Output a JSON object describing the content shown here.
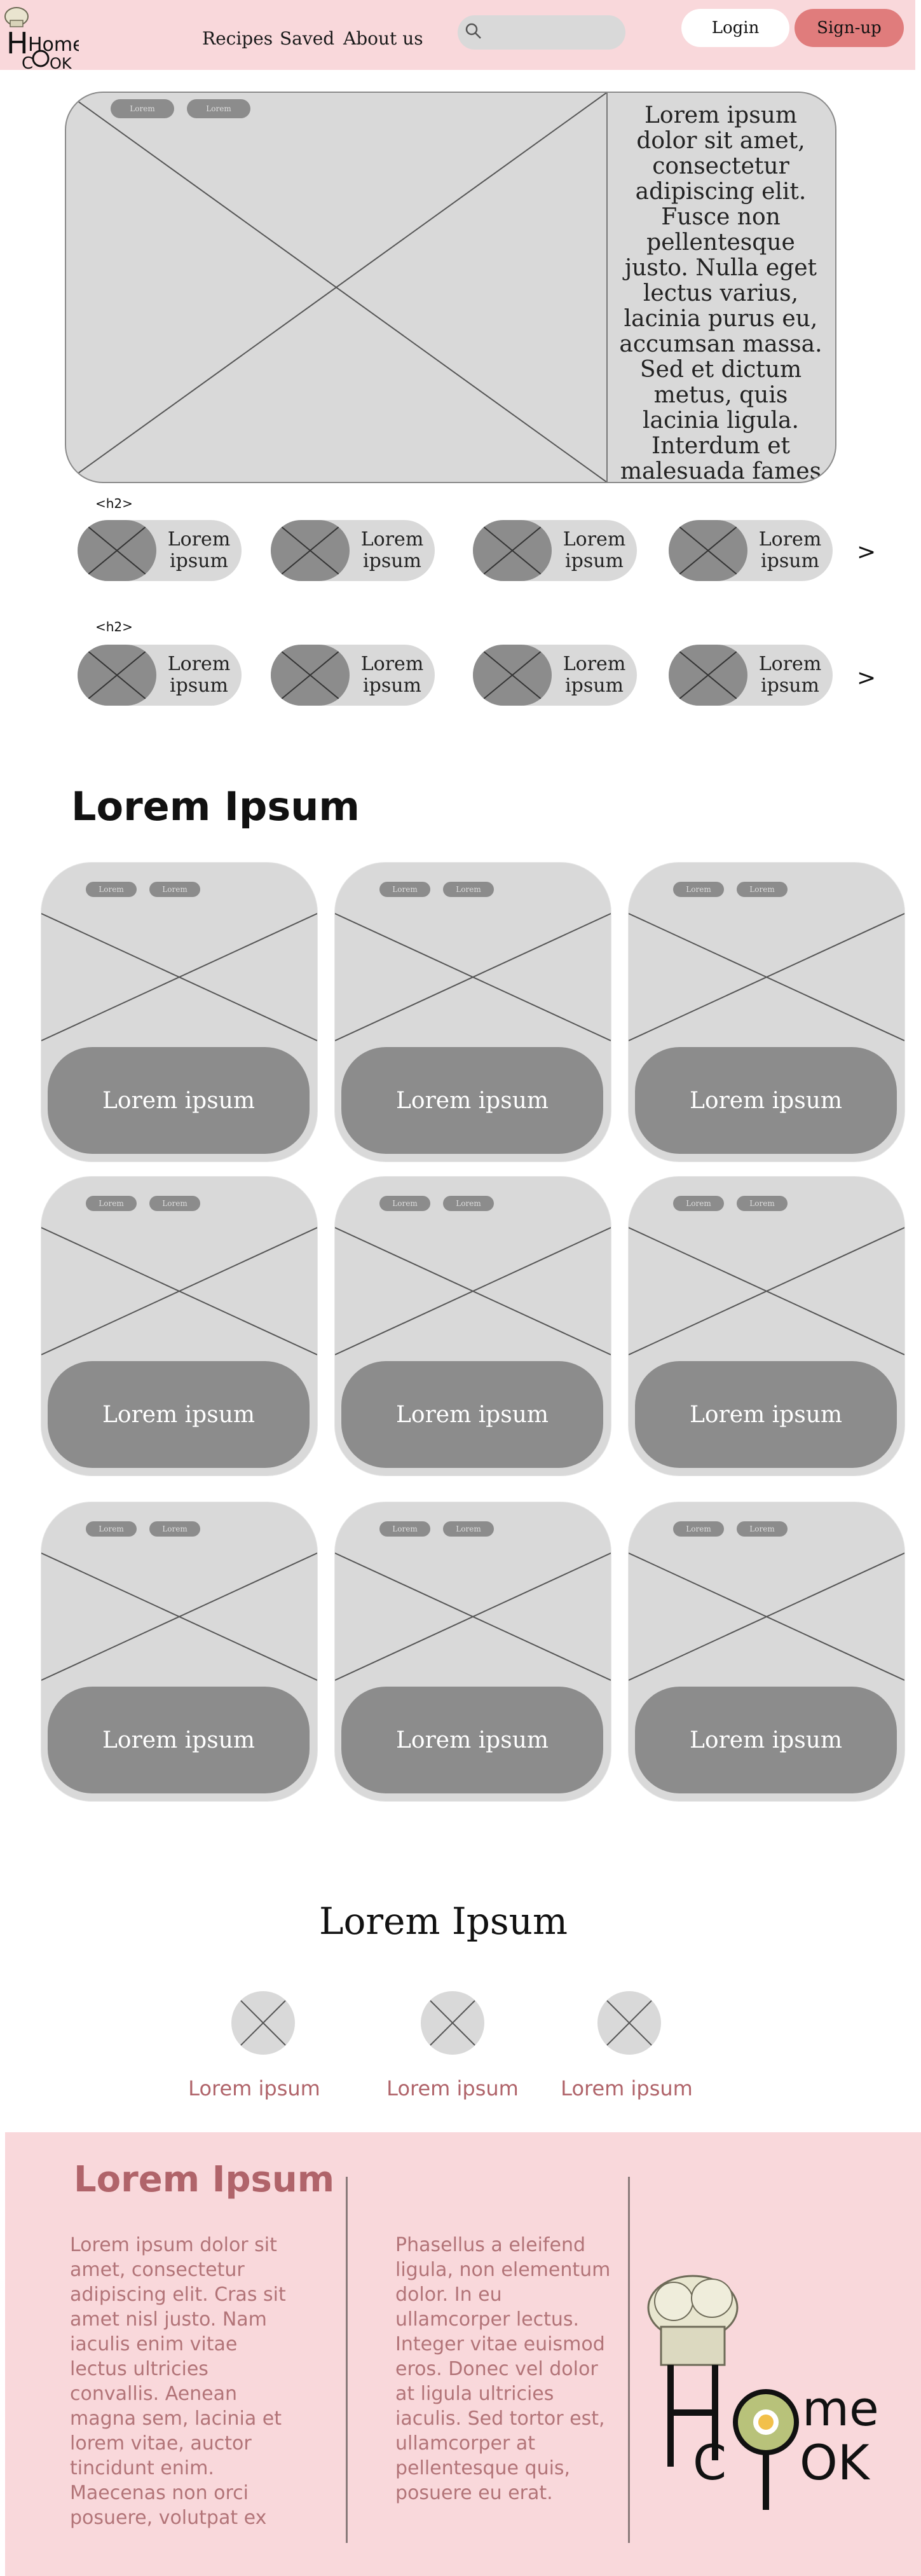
{
  "header": {
    "logo": {
      "text1": "Home",
      "text2": "Cook"
    },
    "nav": [
      "Recipes",
      "Saved",
      "About us"
    ],
    "search_placeholder": "",
    "login_label": "Login",
    "signup_label": "Sign-up"
  },
  "hero": {
    "tags": [
      "Lorem",
      "Lorem"
    ],
    "text": "Lorem ipsum dolor sit amet, consectetur adipiscing elit. Fusce non pellentesque justo. Nulla eget lectus varius, lacinia purus eu, accumsan massa. Sed et dictum metus, quis lacinia ligula. Interdum et malesuada fames"
  },
  "rows": [
    {
      "heading": "<h2>",
      "items": [
        "Lorem ipsum",
        "Lorem ipsum",
        "Lorem ipsum",
        "Lorem ipsum"
      ],
      "arrow": ">"
    },
    {
      "heading": "<h2>",
      "items": [
        "Lorem ipsum",
        "Lorem ipsum",
        "Lorem ipsum",
        "Lorem ipsum"
      ],
      "arrow": ">"
    }
  ],
  "grid": {
    "title": "Lorem Ipsum",
    "cards": [
      {
        "tags": [
          "Lorem",
          "Lorem"
        ],
        "label": "Lorem ipsum"
      },
      {
        "tags": [
          "Lorem",
          "Lorem"
        ],
        "label": "Lorem ipsum"
      },
      {
        "tags": [
          "Lorem",
          "Lorem"
        ],
        "label": "Lorem ipsum"
      },
      {
        "tags": [
          "Lorem",
          "Lorem"
        ],
        "label": "Lorem ipsum"
      },
      {
        "tags": [
          "Lorem",
          "Lorem"
        ],
        "label": "Lorem ipsum"
      },
      {
        "tags": [
          "Lorem",
          "Lorem"
        ],
        "label": "Lorem ipsum"
      },
      {
        "tags": [
          "Lorem",
          "Lorem"
        ],
        "label": "Lorem ipsum"
      },
      {
        "tags": [
          "Lorem",
          "Lorem"
        ],
        "label": "Lorem ipsum"
      },
      {
        "tags": [
          "Lorem",
          "Lorem"
        ],
        "label": "Lorem ipsum"
      }
    ]
  },
  "circles": {
    "title": "Lorem Ipsum",
    "items": [
      "Lorem ipsum",
      "Lorem ipsum",
      "Lorem ipsum"
    ]
  },
  "footer": {
    "title": "Lorem Ipsum",
    "col1": [
      "Lorem ipsum dolor sit",
      "amet, consectetur",
      "adipiscing elit. Cras sit",
      "amet nisl justo. Nam",
      "iaculis enim vitae",
      "lectus ultricies",
      "convallis. Aenean",
      "magna sem, lacinia et",
      "lorem vitae, auctor",
      "tincidunt enim.",
      "Maecenas non orci",
      "posuere, volutpat ex"
    ],
    "col2": [
      "Phasellus a eleifend",
      "ligula, non elementum",
      "dolor. In eu",
      "ullamcorper lectus.",
      "Integer vitae euismod",
      "eros. Donec vel dolor",
      "at ligula ultricies",
      "iaculis. Sed tortor est,",
      "ullamcorper at",
      "pellentesque quis,",
      "posuere eu erat."
    ],
    "logo": {
      "text1": "me",
      "text2": "C",
      "text3": "OK"
    }
  },
  "colors": {
    "pink": "#f9d8db",
    "accent": "#e07c7c",
    "muted_text": "#b0646a",
    "gray": "#d9d9d9",
    "dark_gray": "#8c8c8c"
  }
}
